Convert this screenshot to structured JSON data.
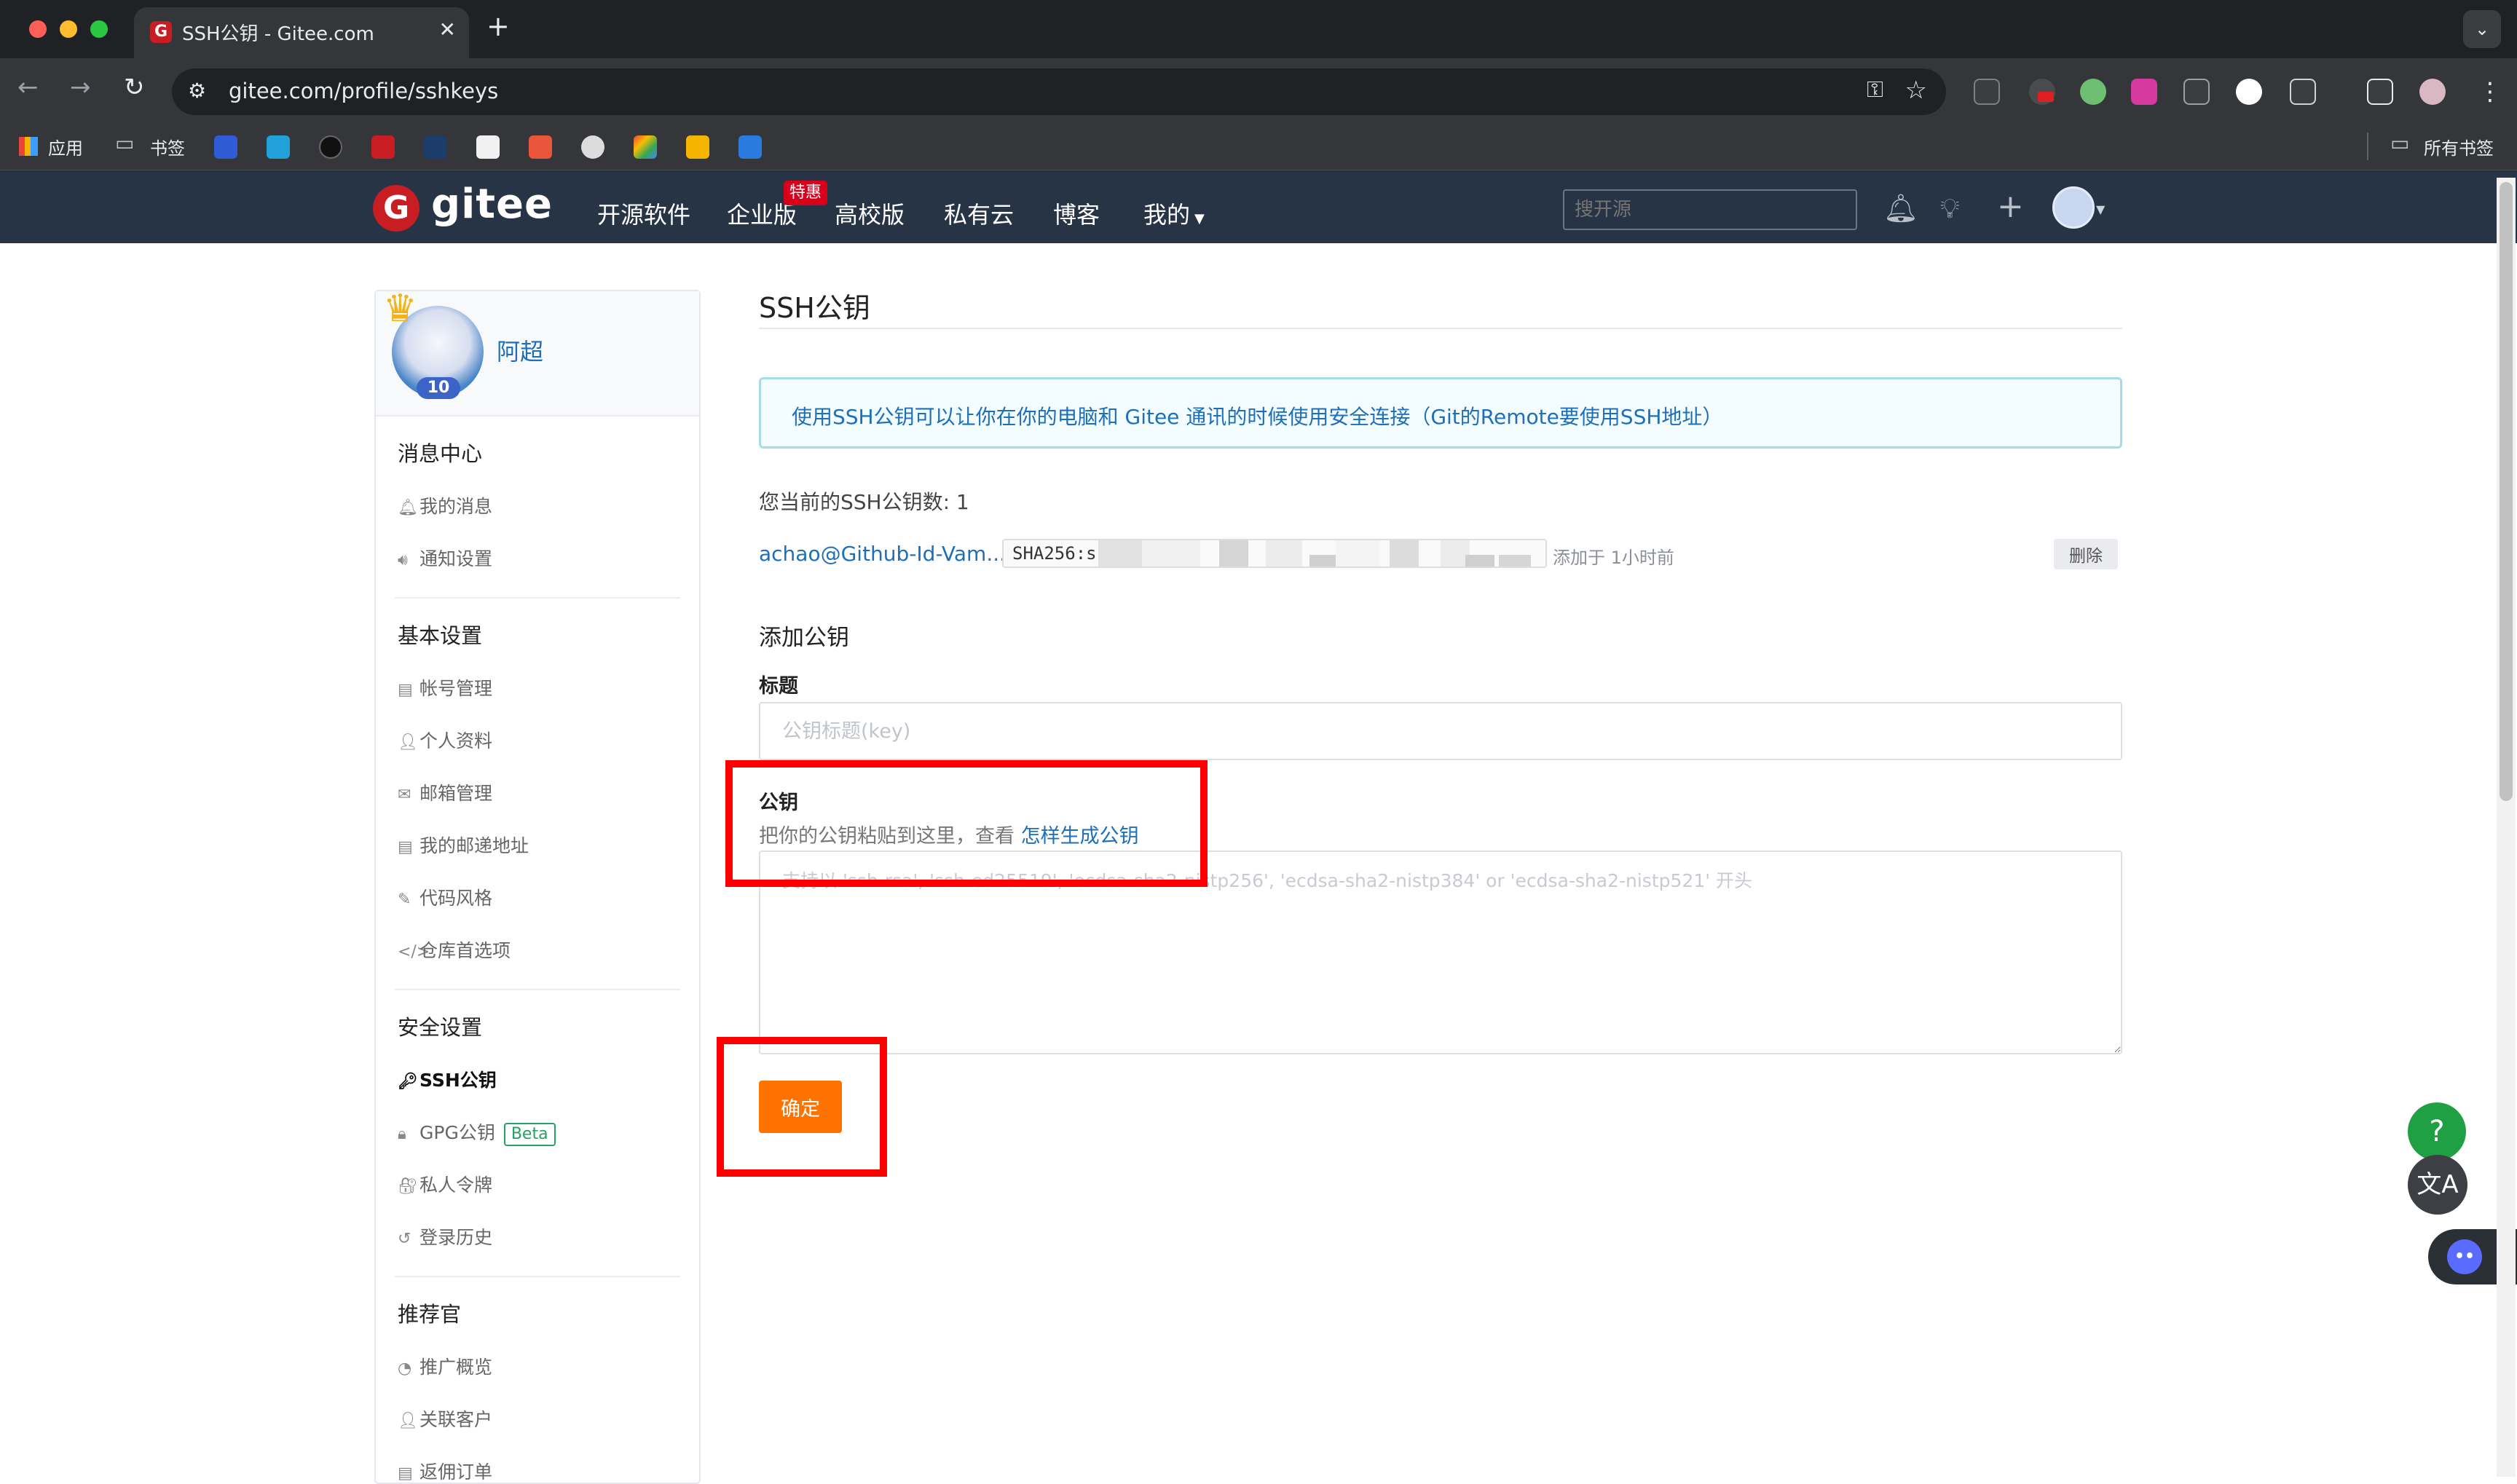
{
  "browser": {
    "tab_title": "SSH公钥 - Gitee.com",
    "tab_close": "✕",
    "new_tab": "+",
    "url": "gitee.com/profile/sshkeys",
    "bookmarks": {
      "apps": "应用",
      "folder": "书签",
      "all_bookmarks": "所有书签"
    }
  },
  "header": {
    "logo_text": "gitee",
    "nav": [
      "开源软件",
      "企业版",
      "高校版",
      "私有云",
      "博客",
      "我的"
    ],
    "hot_badge": "特惠",
    "search_placeholder": "搜开源"
  },
  "sidebar": {
    "username": "阿超",
    "badge_level": "10",
    "sections": [
      {
        "title": "消息中心",
        "items": [
          "我的消息",
          "通知设置"
        ]
      },
      {
        "title": "基本设置",
        "items": [
          "帐号管理",
          "个人资料",
          "邮箱管理",
          "我的邮递地址",
          "代码风格",
          "仓库首选项"
        ]
      },
      {
        "title": "安全设置",
        "items": [
          "SSH公钥",
          "GPG公钥",
          "私人令牌",
          "登录历史"
        ]
      },
      {
        "title": "推荐官",
        "items": [
          "推广概览",
          "关联客户",
          "返佣订单"
        ]
      }
    ],
    "beta_label": "Beta",
    "active_item": "SSH公钥"
  },
  "main": {
    "page_title": "SSH公钥",
    "info": "使用SSH公钥可以让你在你的电脑和 Gitee 通讯的时候使用安全连接（Git的Remote要使用SSH地址）",
    "key_count": "您当前的SSH公钥数: 1",
    "keys": [
      {
        "name": "achao@Github-Id-Vam...",
        "fingerprint": "SHA256:s",
        "added": "添加于 1小时前",
        "delete_label": "删除"
      }
    ],
    "add_title": "添加公钥",
    "title_label": "标题",
    "title_placeholder": "公钥标题(key)",
    "key_label": "公钥",
    "key_hint": "把你的公钥粘贴到这里，查看 ",
    "key_hint_link": "怎样生成公钥",
    "key_placeholder": "支持以 'ssh-rsa', 'ssh-ed25519', 'ecdsa-sha2-nistp256', 'ecdsa-sha2-nistp384' or 'ecdsa-sha2-nistp521' 开头",
    "submit_label": "确定"
  },
  "widgets": {
    "help": "?",
    "translate": "文A"
  },
  "colors": {
    "header_bg": "#263445",
    "brand_red": "#c71d23",
    "primary_orange": "#fe7300",
    "link_blue": "#1e6fb9",
    "highlight_red": "#ff0000"
  }
}
